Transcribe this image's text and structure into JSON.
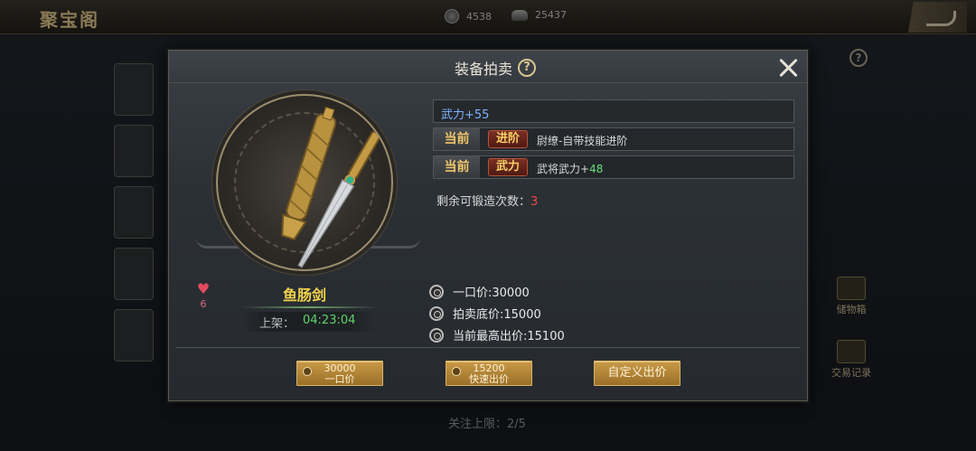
{
  "top_bar": {
    "title": "聚宝阁",
    "currency_1": "4538",
    "currency_2": "25437"
  },
  "side_tabs": {
    "storage": "储物箱",
    "trade_records": "交易记录"
  },
  "bottom_status": "关注上限：2/5",
  "dialog": {
    "title": "装备拍卖",
    "help": "?",
    "item": {
      "name": "鱼肠剑",
      "favorite_count": "6",
      "listing_label": "上架：",
      "listing_time": "04:23:04"
    },
    "attributes": {
      "main_stat": "武力+55",
      "rows": [
        {
          "tag": "当前",
          "type": "进阶",
          "text": "尉缭-自带技能进阶",
          "value": ""
        },
        {
          "tag": "当前",
          "type": "武力",
          "text": "武将武力+",
          "value": "48"
        }
      ],
      "forge_label": "剩余可锻造次数：",
      "forge_count": "3"
    },
    "prices": {
      "buyout": "一口价:30000",
      "reserve": "拍卖底价:15000",
      "highest_bid": "当前最高出价:15100"
    },
    "buttons": {
      "buyout_amount": "30000",
      "buyout_label": "一口价",
      "quick_amount": "15200",
      "quick_label": "快速出价",
      "custom_label": "自定义出价"
    }
  },
  "colors": {
    "item_name": "#f2d24b",
    "main_stat": "#7fb1ff",
    "positive": "#6be07a",
    "timer": "#5fd36a",
    "forge_count": "#e64a4a",
    "button_gold": "#c89a47"
  }
}
